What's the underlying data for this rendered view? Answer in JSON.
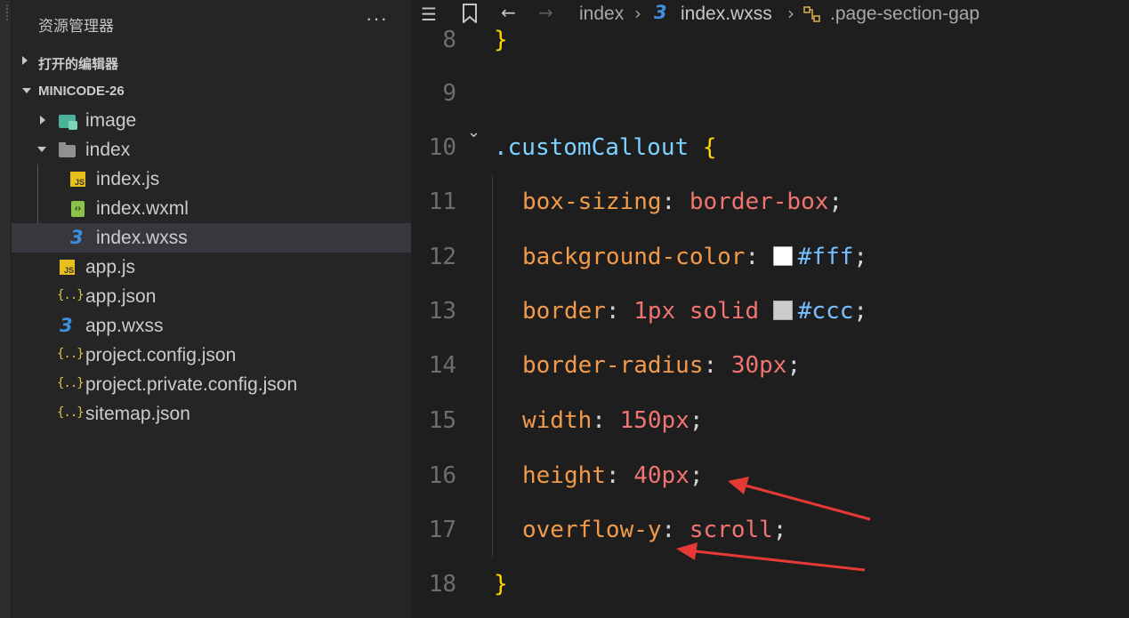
{
  "explorer": {
    "title": "资源管理器",
    "more": "···",
    "open_editors": "打开的编辑器",
    "project": "MINICODE-26",
    "tree": [
      {
        "label": "image",
        "icon": "image-folder-icon",
        "kind": "folder",
        "expanded": false
      },
      {
        "label": "index",
        "icon": "folder-icon",
        "kind": "folder",
        "expanded": true
      },
      {
        "label": "index.js",
        "icon": "js-file-icon",
        "kind": "file"
      },
      {
        "label": "index.wxml",
        "icon": "wxml-file-icon",
        "kind": "file"
      },
      {
        "label": "index.wxss",
        "icon": "css-file-icon",
        "kind": "file",
        "selected": true
      },
      {
        "label": "app.js",
        "icon": "js-file-icon",
        "kind": "file"
      },
      {
        "label": "app.json",
        "icon": "json-file-icon",
        "kind": "file"
      },
      {
        "label": "app.wxss",
        "icon": "css-file-icon",
        "kind": "file"
      },
      {
        "label": "project.config.json",
        "icon": "json-file-icon",
        "kind": "file"
      },
      {
        "label": "project.private.config.json",
        "icon": "json-file-icon",
        "kind": "file"
      },
      {
        "label": "sitemap.json",
        "icon": "json-file-icon",
        "kind": "file"
      }
    ]
  },
  "breadcrumb": {
    "folder": "index",
    "file": "index.wxss",
    "symbol": ".page-section-gap"
  },
  "editor": {
    "lines": [
      {
        "n": "8"
      },
      {
        "n": "9"
      },
      {
        "n": "10",
        "selector": ".customCallout",
        "brace": "{"
      },
      {
        "n": "11",
        "prop": "box-sizing",
        "value": "border-box"
      },
      {
        "n": "12",
        "prop": "background-color",
        "hex": "#fff",
        "swatch": "#ffffff"
      },
      {
        "n": "13",
        "prop": "border",
        "value": "1px solid",
        "hex": "#ccc",
        "swatch": "#cccccc"
      },
      {
        "n": "14",
        "prop": "border-radius",
        "value": "30px"
      },
      {
        "n": "15",
        "prop": "width",
        "value": "150px"
      },
      {
        "n": "16",
        "prop": "height",
        "value": "40px"
      },
      {
        "n": "17",
        "prop": "overflow-y",
        "value": "scroll"
      },
      {
        "n": "18"
      }
    ],
    "close_brace": "}"
  },
  "colors": {
    "annotation_arrow": "#e53935"
  }
}
